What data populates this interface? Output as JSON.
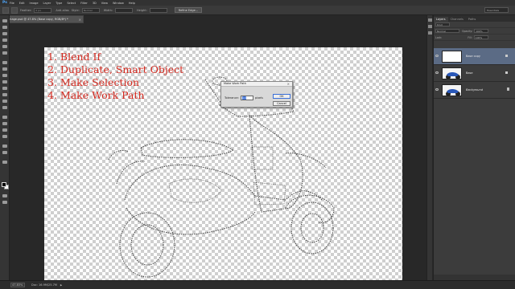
{
  "app": {
    "logo": "Ps",
    "menu": [
      "File",
      "Edit",
      "Image",
      "Layer",
      "Type",
      "Select",
      "Filter",
      "3D",
      "View",
      "Window",
      "Help"
    ]
  },
  "options_bar": {
    "feather_label": "Feather:",
    "feather_value": "0 px",
    "antialias_label": "Anti-alias",
    "style_label": "Style:",
    "style_value": "Normal",
    "width_label": "Width:",
    "height_label": "Height:",
    "refine_button": "Refine Edge...",
    "workspace": "Essentials"
  },
  "document_tab": {
    "title": "Image.psd @ 47.8% (Base copy, RGB/8*) *",
    "close": "×"
  },
  "canvas": {
    "steps": [
      "1. Blend If",
      "2. Duplicate, Smart Object",
      "3. Make Selection",
      "4. Make Work Path"
    ]
  },
  "dialog": {
    "title": "Make Work Path",
    "close": "×",
    "tolerance_label": "Tolerance:",
    "tolerance_value": "1.0",
    "unit": "pixels",
    "ok": "OK",
    "cancel": "Cancel"
  },
  "layers_panel": {
    "tabs": [
      "Layers",
      "Channels",
      "Paths"
    ],
    "kind": "Kind",
    "blend_mode": "Normal",
    "opacity_label": "Opacity:",
    "opacity_value": "100%",
    "lock_label": "Lock:",
    "fill_label": "Fill:",
    "fill_value": "100%",
    "layers": [
      {
        "name": "Base copy",
        "selected": true
      },
      {
        "name": "Base",
        "selected": false
      },
      {
        "name": "Background",
        "selected": false
      }
    ]
  },
  "status": {
    "zoom": "47.83%",
    "doc": "Doc: 16.9M/25.7M"
  },
  "colors": {
    "accent": "#d42a20",
    "selection": "#5b6b85"
  }
}
